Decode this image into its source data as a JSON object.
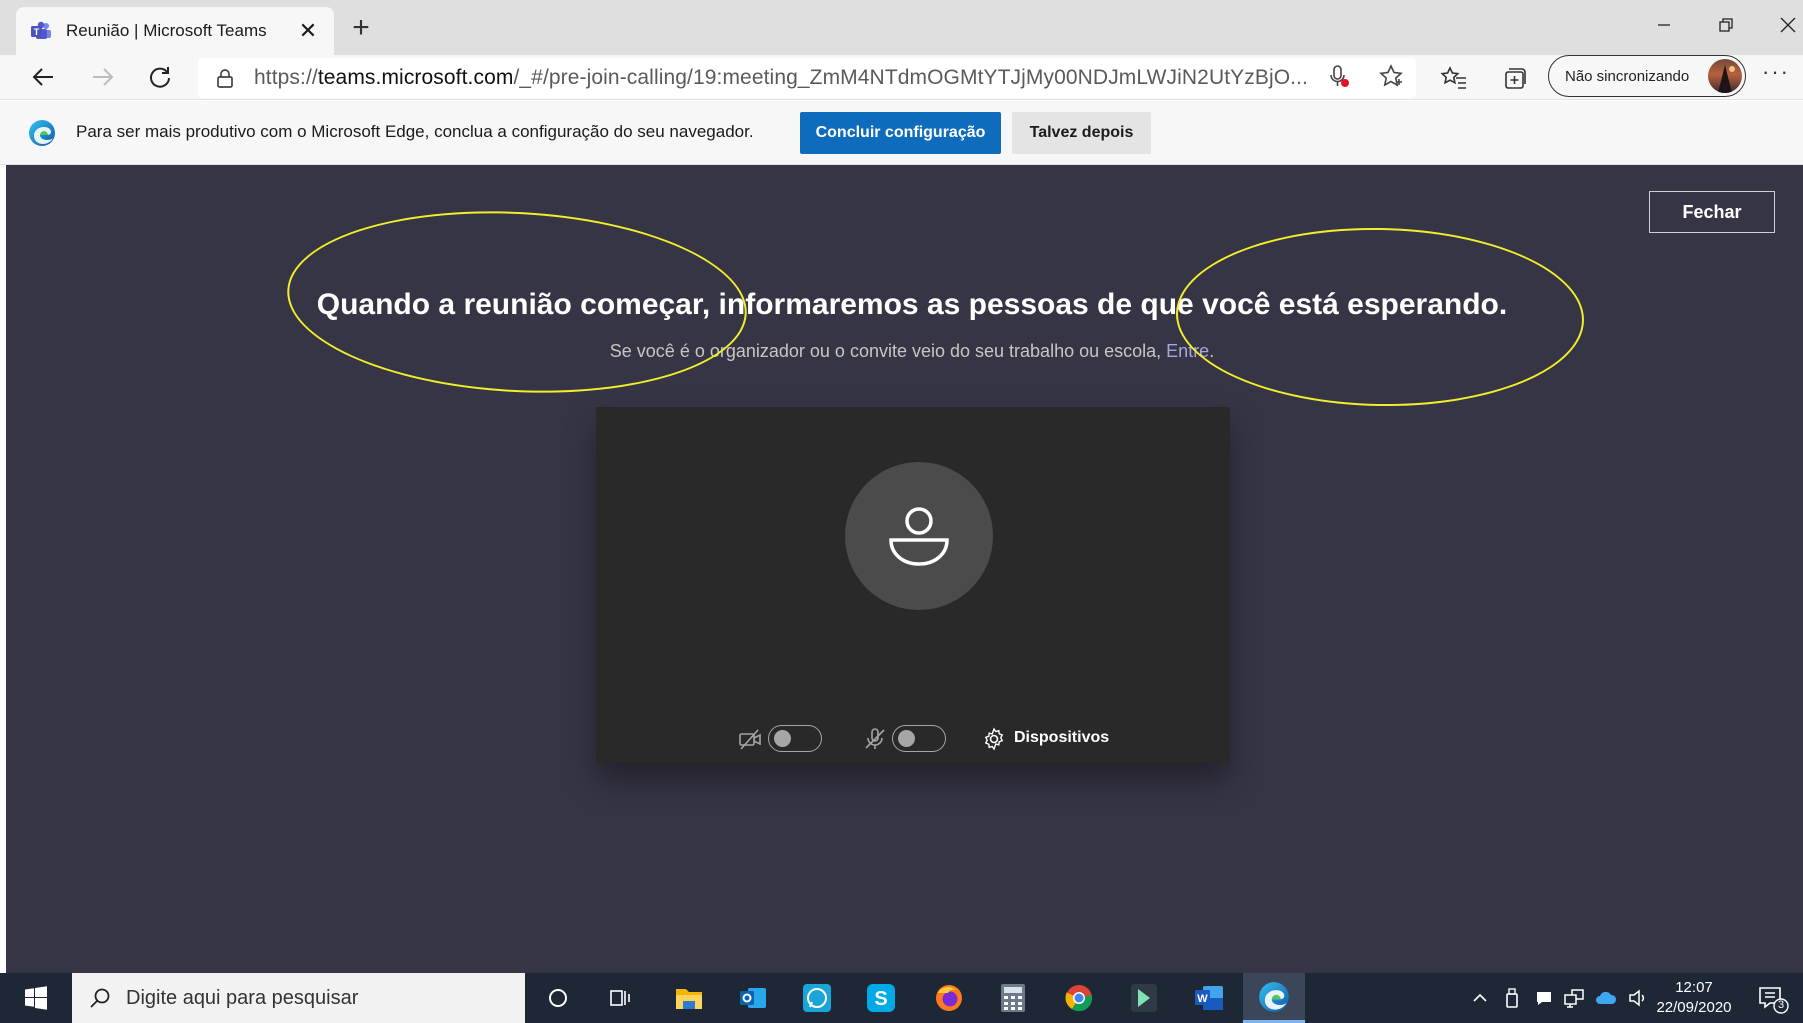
{
  "browser": {
    "tab": {
      "title": "Reunião | Microsoft Teams",
      "close": "✕"
    },
    "new_tab": "+",
    "window_controls": {
      "minimize": "–",
      "restore": "❐",
      "close": "✕"
    },
    "url": {
      "scheme": "https://",
      "host": "teams.microsoft.com",
      "path": "/_#/pre-join-calling/19:meeting_ZmM4NTdmOGMtYTJjMy00NDJmLWJiN2UtYzBjO..."
    },
    "profile": {
      "label": "Não sincronizando"
    },
    "more": "···"
  },
  "infobar": {
    "message": "Para ser mais produtivo com o Microsoft Edge, conclua a configuração do seu navegador.",
    "primary_button": "Concluir configuração",
    "secondary_button": "Talvez depois"
  },
  "teams": {
    "close_button": "Fechar",
    "headline": "Quando a reunião começar, informaremos as pessoas de que você está esperando.",
    "subline": "Se você é o organizador ou o convite veio do seu trabalho ou escola,",
    "sign_in_link": "Entre",
    "subline_end": ".",
    "camera_on": false,
    "mic_on": false,
    "devices_label": "Dispositivos"
  },
  "taskbar": {
    "search_placeholder": "Digite aqui para pesquisar",
    "apps": [
      "cortana-icon",
      "task-view-icon",
      "file-explorer-icon",
      "outlook-icon",
      "whatsapp-icon",
      "skype-icon",
      "firefox-icon",
      "calculator-icon",
      "chrome-icon",
      "app-arrow-icon",
      "word-icon",
      "edge-icon"
    ],
    "time": "12:07",
    "date": "22/09/2020",
    "notification_count": "3"
  },
  "colors": {
    "teams_bg": "#363545",
    "preview_bg": "#292929",
    "edge_blue": "#0f6cbd",
    "annotation": "#f2ee2c",
    "link": "#a6a7dc",
    "taskbar": "#1d2736"
  }
}
